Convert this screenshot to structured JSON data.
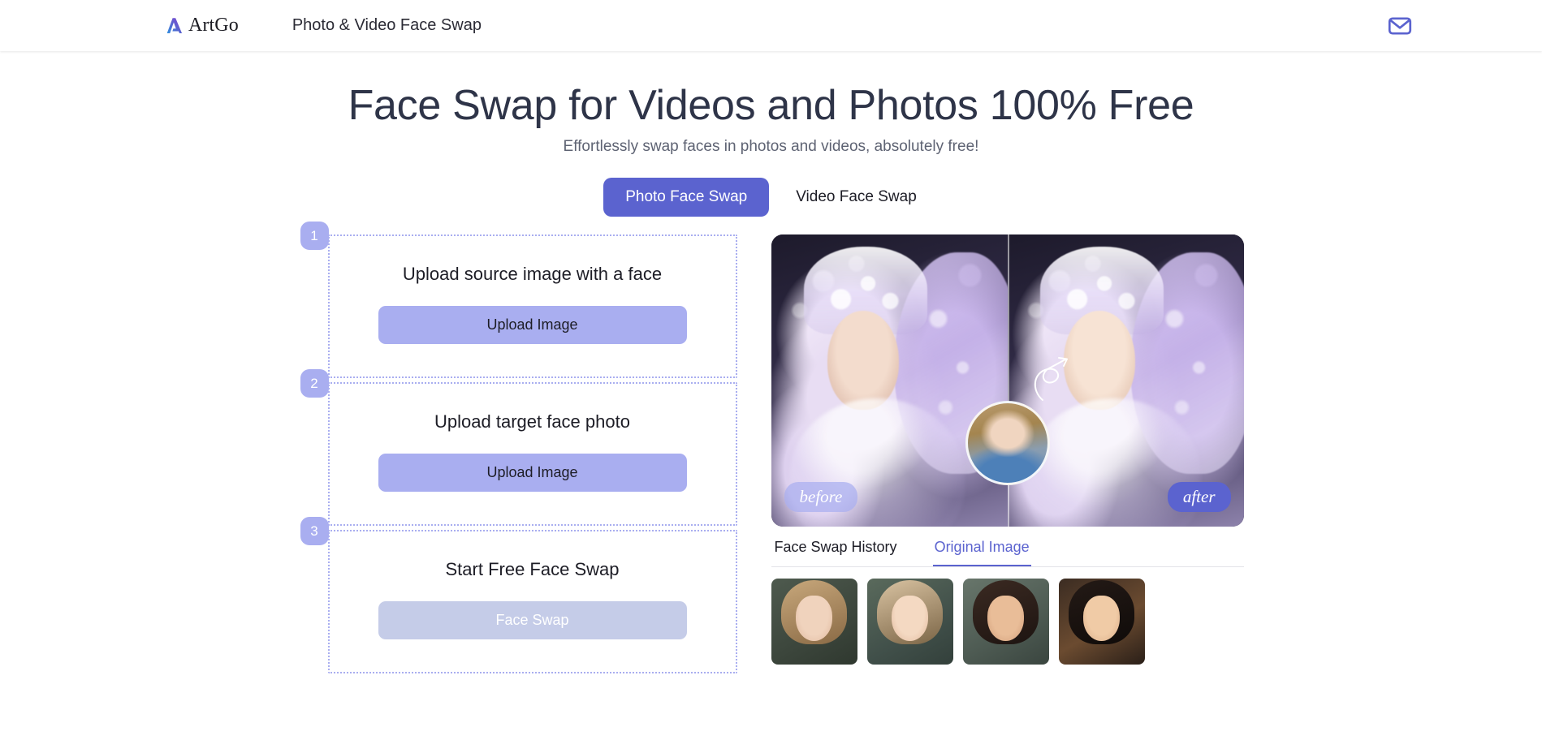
{
  "header": {
    "logo_icon": "artgo-logo-icon",
    "brand": "ArtGo",
    "tagline": "Photo & Video Face Swap",
    "mail_icon": "mail-envelope-icon"
  },
  "hero": {
    "title": "Face Swap for Videos and Photos 100% Free",
    "subtitle": "Effortlessly swap faces in photos and videos, absolutely free!"
  },
  "mode_tabs": [
    {
      "label": "Photo Face Swap",
      "active": true
    },
    {
      "label": "Video Face Swap",
      "active": false
    }
  ],
  "steps": [
    {
      "number": "1",
      "title": "Upload source image with a face",
      "button": "Upload Image",
      "disabled": false
    },
    {
      "number": "2",
      "title": "Upload target face photo",
      "button": "Upload Image",
      "disabled": false
    },
    {
      "number": "3",
      "title": "Start Free Face Swap",
      "button": "Face Swap",
      "disabled": true
    }
  ],
  "preview": {
    "before_label": "before",
    "after_label": "after",
    "overlay_face_name": "source-face-thumbnail",
    "arrow_icon": "curved-arrow-icon"
  },
  "result_tabs": [
    {
      "label": "Face Swap History",
      "active": false
    },
    {
      "label": "Original Image",
      "active": true
    }
  ],
  "thumbnails": [
    {
      "name": "thumbnail-1"
    },
    {
      "name": "thumbnail-2"
    },
    {
      "name": "thumbnail-3"
    },
    {
      "name": "thumbnail-4"
    }
  ],
  "colors": {
    "accent": "#5b63cf",
    "accent_light": "#a9aef0",
    "disabled": "#c5cce8",
    "title": "#2e3448",
    "subtitle": "#5e6373"
  }
}
